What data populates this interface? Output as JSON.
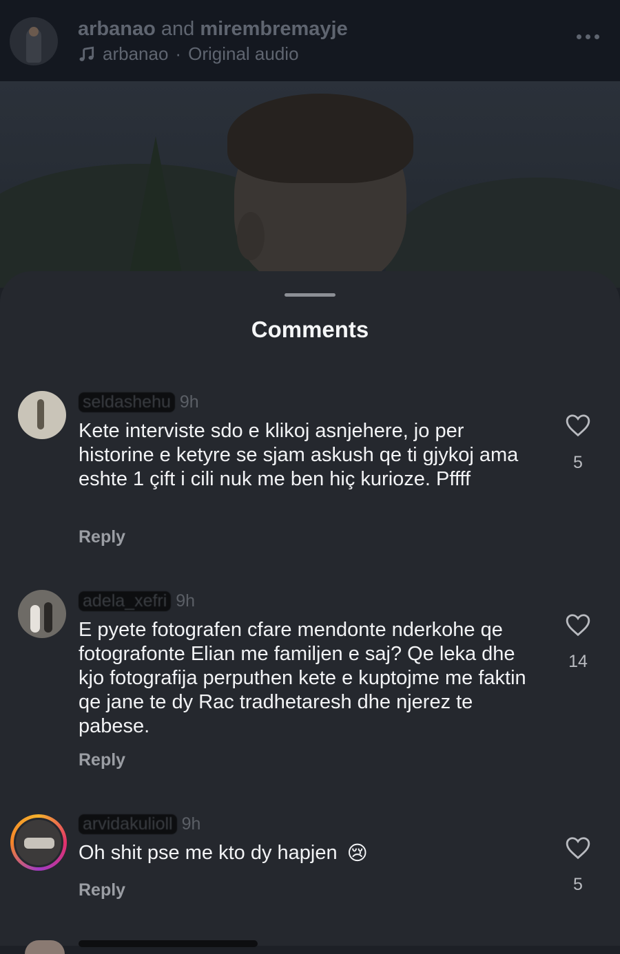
{
  "header": {
    "user1": "arbanao",
    "and": "and",
    "user2": "mirembremayje",
    "audio_owner": "arbanao",
    "audio_sep": "·",
    "audio_label": "Original audio",
    "music_icon": "music-note-icon",
    "more_icon": "more-horizontal-icon"
  },
  "sheet": {
    "title": "Comments"
  },
  "comments": [
    {
      "username": "seldashehu",
      "time": "9h",
      "text": "Kete interviste sdo e klikoj asnjehere, jo per historine e ketyre se sjam askush qe ti gjykoj ama eshte 1 çift i cili nuk me ben hiç kurioze. Pffff",
      "reply_label": "Reply",
      "likes": "5"
    },
    {
      "username": "adela_xefri",
      "time": "9h",
      "text": "E pyete fotografen cfare mendonte nderkohe qe fotografonte Elian me familjen e saj? Qe leka dhe kjo  fotografija perputhen kete e kuptojme me faktin qe jane te dy  Rac tradhetaresh dhe njerez te pabese.",
      "reply_label": "Reply",
      "likes": "14"
    },
    {
      "username": "arvidakulioll",
      "time": "9h",
      "text": "Oh shit pse me kto dy hapjen",
      "emoji": "😢",
      "reply_label": "Reply",
      "likes": "5"
    }
  ]
}
